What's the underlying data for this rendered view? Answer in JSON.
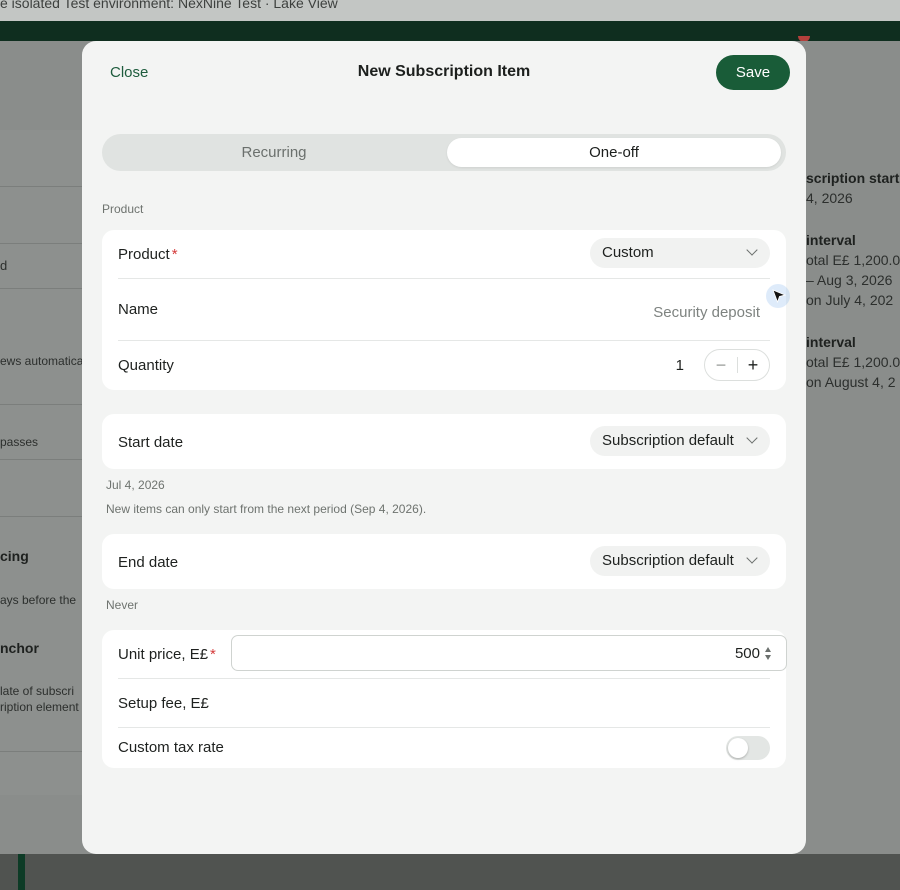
{
  "background": {
    "banner_text": "e isolated Test environment: NexNine Test · Lake View",
    "left_fragments": [
      "d",
      "ews automatica",
      "passes",
      "cing",
      "ays before the",
      "nchor",
      "late of subscri",
      "ription element"
    ],
    "right_fragments": [
      "scription start",
      "4, 2026",
      "interval",
      "otal E£ 1,200.0",
      "– Aug 3, 2026",
      "on July 4, 202",
      "interval",
      "otal E£ 1,200.0",
      "on August 4, 2"
    ]
  },
  "modal": {
    "close_label": "Close",
    "title": "New Subscription Item",
    "save_label": "Save",
    "tabs": [
      {
        "label": "Recurring",
        "selected": false
      },
      {
        "label": "One-off",
        "selected": true
      }
    ],
    "product_section_label": "Product",
    "product": {
      "label": "Product",
      "required": "*",
      "value": "Custom"
    },
    "name": {
      "label": "Name",
      "placeholder": "Security deposit"
    },
    "quantity": {
      "label": "Quantity",
      "value": "1",
      "minus": "−",
      "plus": "+"
    },
    "start_date": {
      "label": "Start date",
      "value": "Subscription default",
      "hint_date": "Jul 4, 2026",
      "hint_note": "New items can only start from the next period (Sep 4, 2026)."
    },
    "end_date": {
      "label": "End date",
      "value": "Subscription default",
      "hint": "Never"
    },
    "unit_price": {
      "label": "Unit price, E£",
      "required": "*",
      "value": "500"
    },
    "setup_fee": {
      "label": "Setup fee, E£"
    },
    "custom_tax": {
      "label": "Custom tax rate",
      "enabled": false
    }
  },
  "colors": {
    "accent": "#195c38",
    "required": "#d43a3a"
  }
}
